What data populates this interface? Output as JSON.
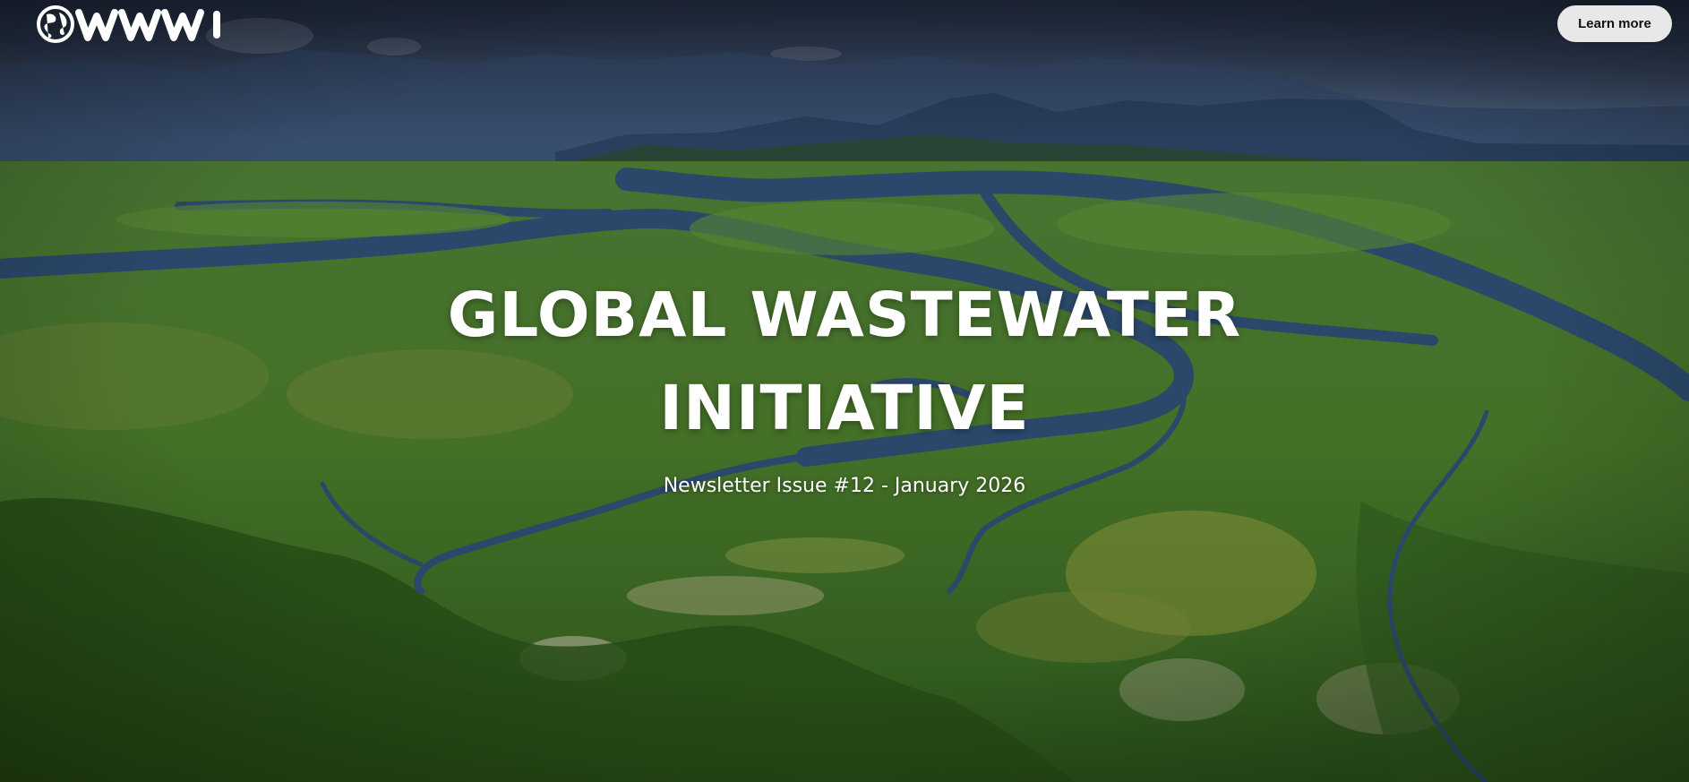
{
  "brand": {
    "logo_text": "WWI",
    "logo_icon": "globe-icon"
  },
  "header": {
    "learn_more_label": "Learn more"
  },
  "hero": {
    "title_line1": "GLOBAL WASTEWATER",
    "title_line2": "INITIATIVE",
    "subtitle": "Newsletter Issue #12 - January 2026"
  },
  "colors": {
    "title_text": "#ffffff",
    "button_bg": "#e8e8e8",
    "button_text": "#111111",
    "vegetation": "#4a7c2e",
    "river": "#2f4e73",
    "sky": "#2b3a52"
  }
}
